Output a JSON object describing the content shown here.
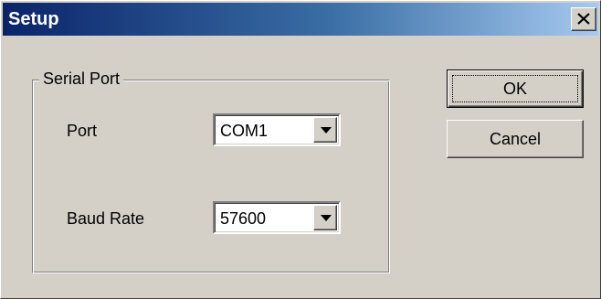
{
  "window": {
    "title": "Setup",
    "close_icon": "close-icon"
  },
  "group": {
    "legend": "Serial Port"
  },
  "port": {
    "label": "Port",
    "value": "COM1",
    "dropdown_icon": "chevron-down-icon"
  },
  "baud": {
    "label": "Baud Rate",
    "value": "57600",
    "dropdown_icon": "chevron-down-icon"
  },
  "buttons": {
    "ok_label": "OK",
    "cancel_label": "Cancel"
  },
  "colors": {
    "face": "#d4d0c8",
    "title_start": "#0a246a",
    "title_end": "#a6caf0"
  }
}
